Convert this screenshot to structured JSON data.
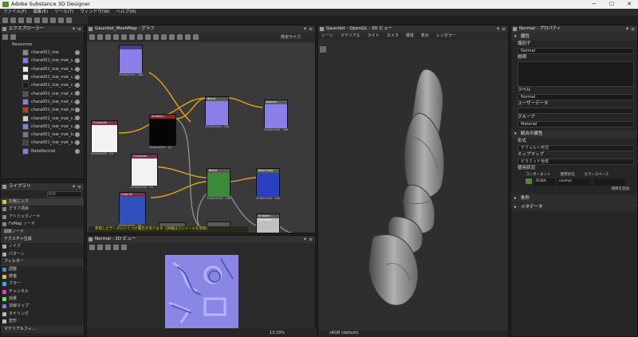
{
  "window": {
    "title": "Adobe Substance 3D Designer",
    "minimize": "─",
    "maximize": "☐",
    "close": "✕"
  },
  "menu": [
    "ファイル(F)",
    "編集(E)",
    "ツール(T)",
    "ウィンドウ(W)",
    "ヘルプ(H)"
  ],
  "explorer": {
    "title": "エクスプローラー",
    "resources_label": "Resources",
    "items": [
      {
        "label": "chara001_low",
        "color": "#8a8a8a"
      },
      {
        "label": "chara001_low_mat_s...",
        "color": "#7d7cf2"
      },
      {
        "label": "chara001_low_mat_s...",
        "color": "#e8e8e8"
      },
      {
        "label": "chara001_low_mat_c...",
        "color": "#e8e8e8"
      },
      {
        "label": "chara001_low_mat_c...",
        "color": "#1a1a1a"
      },
      {
        "label": "chara001_low_mat_c...",
        "color": "#555"
      },
      {
        "label": "chara001_low_mat_c...",
        "color": "#8080ff"
      },
      {
        "label": "chara001_low_mat_m...",
        "color": "#c0392b"
      },
      {
        "label": "chara001_low_mat_c...",
        "color": "#cfcfcf"
      },
      {
        "label": "chara001_low_mat_c...",
        "color": "#7d7cf2"
      },
      {
        "label": "chara001_low_mat_b...",
        "color": "#777"
      },
      {
        "label": "chara001_low_mat_s...",
        "color": "#444"
      },
      {
        "label": "BakeNormal",
        "color": "#7d7cf2"
      }
    ]
  },
  "library": {
    "title": "ライブラリ",
    "search_placeholder": "検索",
    "favorites": "お気に入り",
    "items": [
      {
        "label": "グラフ項目",
        "color": "#888"
      },
      {
        "label": "アトミックノード",
        "color": "#888"
      },
      {
        "label": "FxMap ノード",
        "color": "#888"
      }
    ],
    "function_nodes": "関数ノード",
    "texture_gen": "テクスチャ生成",
    "gen_items": [
      {
        "label": "ノイズ",
        "color": "#aaa"
      },
      {
        "label": "パターン",
        "color": "#aaa"
      }
    ],
    "filters": "フィルター",
    "filter_items": [
      {
        "label": "調整",
        "color": "#3a8ee6"
      },
      {
        "label": "修復",
        "color": "#d9c33a"
      },
      {
        "label": "ブラー",
        "color": "#3ab0e6"
      },
      {
        "label": "チャンネル",
        "color": "#e63ad6"
      },
      {
        "label": "効果",
        "color": "#7ae63a"
      },
      {
        "label": "法線マップ",
        "color": "#7d7cf2"
      },
      {
        "label": "タイリング",
        "color": "#bbb"
      },
      {
        "label": "変形",
        "color": "#bbb"
      }
    ],
    "material_filters": "マテリアルフィ..."
  },
  "graph": {
    "title": "Gauntlet_MeshMap - グラフ",
    "fit_label": "既定サイズ",
    "nodes": [
      {
        "title": "",
        "size_label": "2048x2048 - 16b",
        "color": "#8a7fe8",
        "title_color": "#4a3f8a"
      },
      {
        "title": "Curvature",
        "size_label": "4096x4096 - 16",
        "color": "#f2f2f2",
        "title_color": "#7a3050"
      },
      {
        "title": "Ambient...",
        "size_label": "4096x4096 - 16",
        "color": "#050505",
        "title_color": "#8a2030"
      },
      {
        "title": "Blend",
        "size_label": "2048x2048 - 16b",
        "color": "#8a7fe8",
        "title_color": "#5a5a5a"
      },
      {
        "title": "Normal",
        "size_label": "2048x2048 - 16b",
        "color": "#8a7fe8",
        "title_color": "#5a5a5a"
      },
      {
        "title": "Curvature",
        "size_label": "4096x4096 - 16",
        "color": "#f2f2f2",
        "title_color": "#7a3050"
      },
      {
        "title": "Color ID",
        "size_label": "4096x4096 - 16",
        "color": "#3050c0",
        "title_color": "#7a3050"
      },
      {
        "title": "Blend",
        "size_label": "2048x2048 - 16b",
        "color": "#3a8a3a",
        "title_color": "#5a5a5a"
      },
      {
        "title": "Base Color",
        "size_label": "2048x2048 - 16b",
        "color": "#2a40c0",
        "title_color": "#5a5a5a"
      },
      {
        "title": "",
        "size_label": "2048x2048 - 16b",
        "color": "#d0d0d0",
        "title_color": "#5a5a5a"
      },
      {
        "title": "",
        "size_label": "2048x2048 - 16b",
        "color": "#a0a0a0",
        "title_color": "#5a5a5a"
      },
      {
        "title": "Ambient Occlusion",
        "size_label": "2048x2048 - 16b",
        "color": "#c0c0c0",
        "title_color": "#5a5a5a"
      }
    ],
    "warning_text": "参照したデータにいくつか警告があります（詳細はコンソールを参照）"
  },
  "view2d": {
    "title": "Normal - 2D ビュー",
    "zoom": "13.33%"
  },
  "view3d": {
    "title": "Gauntlet - OpenGL - 3D ビュー",
    "tabs": [
      "シーン",
      "マテリアル",
      "ライト",
      "カメラ",
      "環境",
      "表示",
      "レンダラー"
    ],
    "colorspace": "sRGB (default)"
  },
  "properties": {
    "title": "Normal - プロパティ",
    "attributes": "属性",
    "identifier_label": "識別子",
    "identifier_value": "Normal",
    "description_label": "説明",
    "label_label": "ラベル",
    "label_value": "Normal",
    "userdata_label": "ユーザーデータ",
    "group_label": "グループ",
    "group_value": "Material",
    "bundle_attributes": "統合の属性",
    "format_label": "形式",
    "format_value": "デフォルト形式",
    "mipmap_label": "ミップマップ",
    "mipmap_value": "ピラミッド全体",
    "usage_label": "使用状況",
    "component_label": "コンポーネント",
    "usage_col_label": "使用状況",
    "colorspace_label": "カラースペース",
    "component_value": "RGBA",
    "usage_value": "normal",
    "add_usage": "項目を追加",
    "conditions": "条件",
    "metadata": "メタデータ"
  }
}
